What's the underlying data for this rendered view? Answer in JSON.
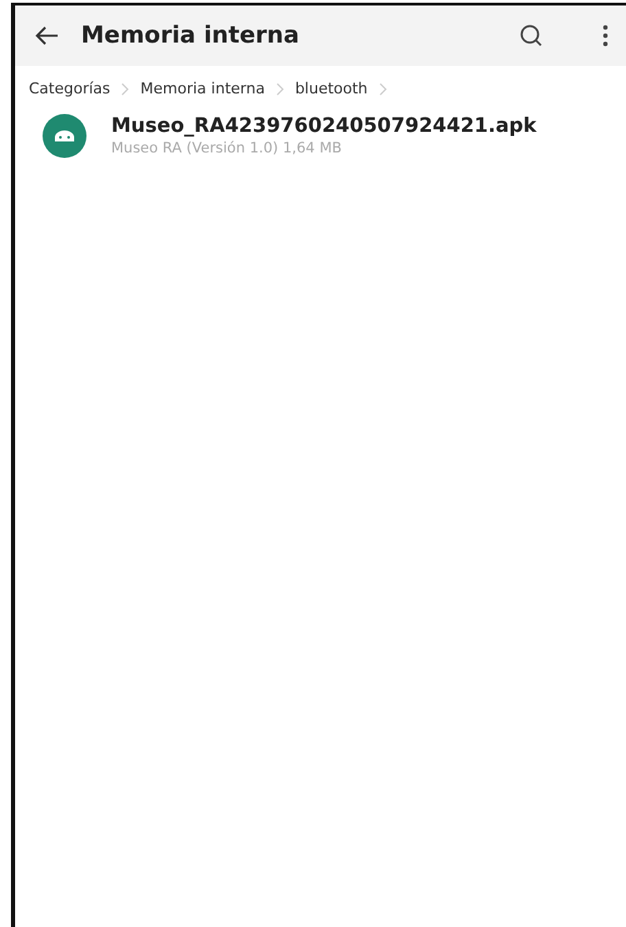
{
  "app_bar": {
    "title": "Memoria interna"
  },
  "breadcrumbs": [
    {
      "label": "Categorías"
    },
    {
      "label": "Memoria interna"
    },
    {
      "label": "bluetooth"
    }
  ],
  "files": [
    {
      "name": "Museo_RA4239760240507924421.apk",
      "details": "Museo RA (Versión 1.0) 1,64 MB"
    }
  ]
}
